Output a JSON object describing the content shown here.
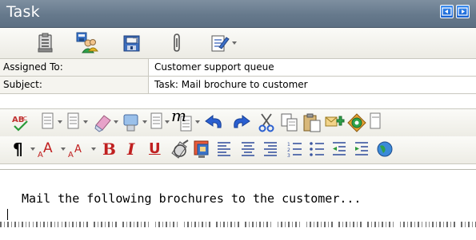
{
  "window": {
    "title": "Task",
    "nav_icons": [
      "previous-item-icon",
      "next-item-icon"
    ]
  },
  "toolbar": {
    "buttons": [
      "clipboard-list-icon",
      "assign-users-icon",
      "save-close-icon",
      "attach-paperclip-icon",
      "notes-edit-icon"
    ]
  },
  "fields": {
    "assigned_to_label": "Assigned To:",
    "assigned_to_value": "Customer support queue",
    "subject_label": "Subject:",
    "subject_value": "Task: Mail brochure to customer"
  },
  "format_toolbar_1": {
    "icons": [
      "spell-check-icon",
      "template-icon",
      "style-icon",
      "eraser-icon",
      "insert-object-icon",
      "document-icon",
      "math-m-icon",
      "undo-icon",
      "redo-icon",
      "cut-icon",
      "copy-icon",
      "paste-icon",
      "insert-link-icon",
      "globe-icon"
    ]
  },
  "format_toolbar_2": {
    "icons": [
      "paragraph-icon",
      "font-grow-icon",
      "font-shrink-icon",
      "bold-icon",
      "italic-icon",
      "underline-icon",
      "highlight-icon",
      "font-color-icon",
      "align-left-icon",
      "align-center-icon",
      "align-right-icon",
      "numbered-list-icon",
      "bullet-list-icon",
      "outdent-icon",
      "indent-icon"
    ],
    "bold_label": "B",
    "italic_label": "I",
    "underline_label": "U",
    "paragraph_glyph": "¶",
    "font_glyph": "A"
  },
  "body": {
    "text": "Mail the following brochures to the customer..."
  },
  "colors": {
    "title_bar": "#66798c",
    "nav_button": "#1560d0",
    "undo_redo": "#2a5fd0"
  }
}
